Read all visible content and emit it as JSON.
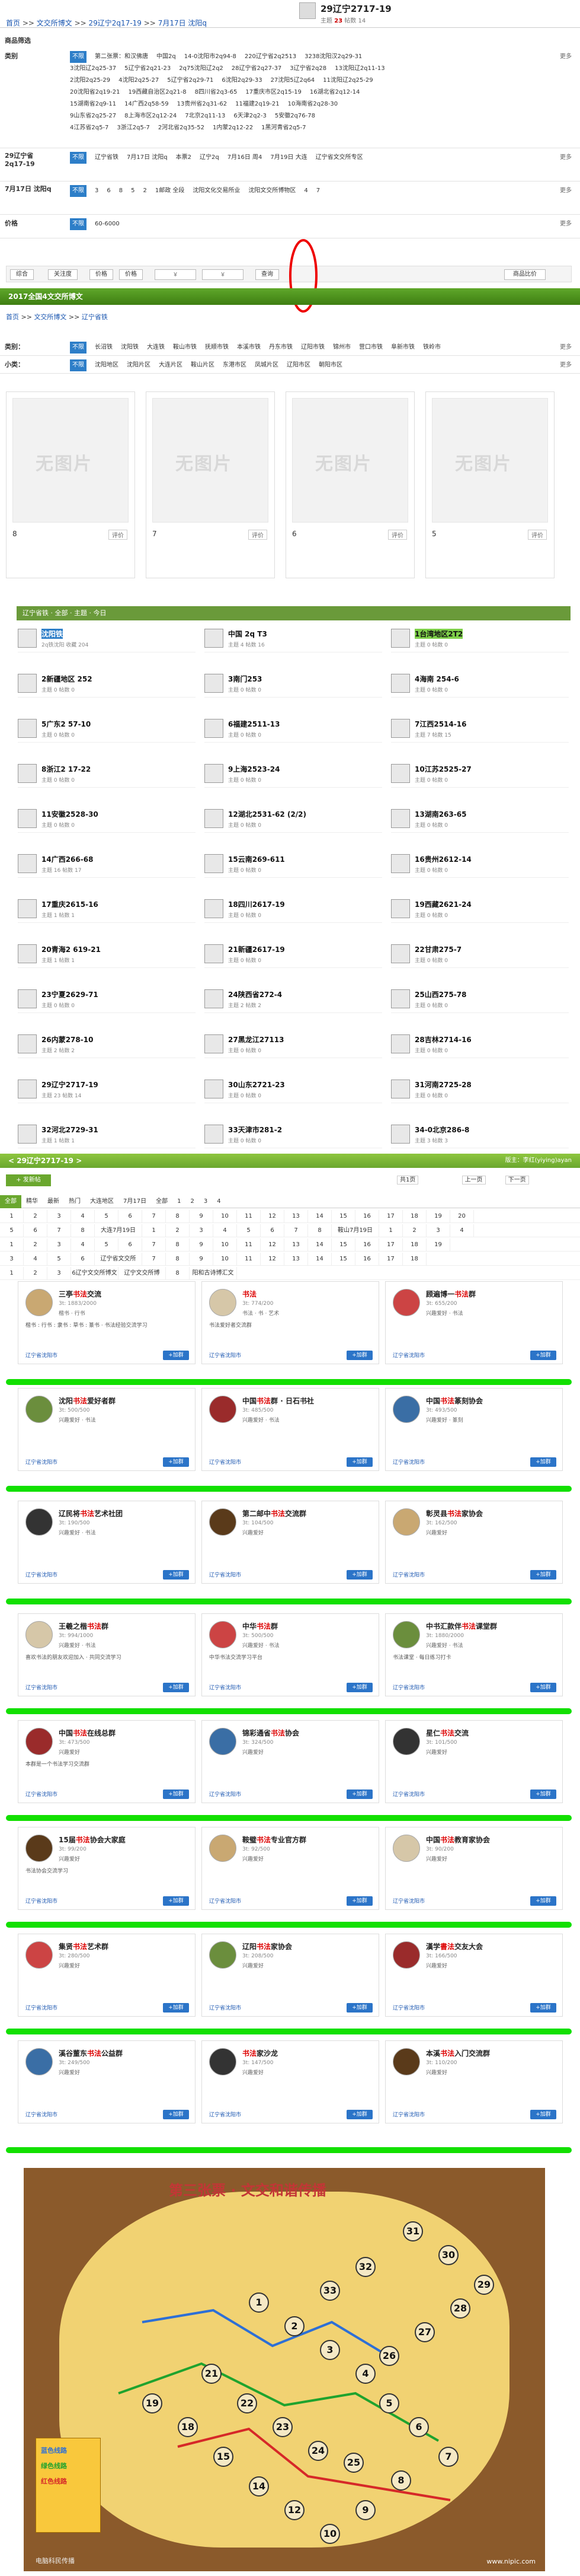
{
  "breadcrumb": [
    "首页",
    "文交所博文",
    "29辽宁2q17-19",
    "7月17日 沈阳q"
  ],
  "item": {
    "title": "29辽宁2717-19",
    "stats_label": "主题",
    "stats_value": "23",
    "stats_more": "帖数 14"
  },
  "product_label": "商品筛选",
  "category": {
    "label": "类别",
    "more": "更多",
    "rows": [
      [
        "不限",
        "第二张票：和汉佛唐",
        "中国2q",
        "14-0沈阳市2q94-8",
        "220辽宁省2q2513",
        "3238沈阳汉2q29-31"
      ],
      [
        "3沈阳辽2q25-37",
        "5辽宁省2q21-23",
        "2q75沈阳辽2q2",
        "28辽宁省2q27-37",
        "3辽宁省2q28",
        "13沈阳辽2q11-13"
      ],
      [
        "2沈阳2q25-29",
        "4沈阳2q25-27",
        "5辽宁省2q29-71",
        "6沈阳2q29-33",
        "27沈阳5辽2q64",
        "11沈阳辽2q25-29"
      ],
      [
        "20沈阳省2q19-21",
        "19西藏自治区2q21-8",
        "8四川省2q3-65",
        "17重庆市区2q15-19",
        "16湖北省2q12-14"
      ],
      [
        "15湖南省2q9-11",
        "14广西2q58-59",
        "13贵州省2q31-62",
        "11福建2q19-21",
        "10海南省2q28-30"
      ],
      [
        "9山东省2q25-27",
        "8上海市区2q12-24",
        "7北京2q11-13",
        "6天津2q2-3",
        "5安徽2q76-78"
      ],
      [
        "4江苏省2q5-7",
        "3浙江2q5-7",
        "2河北省2q35-52",
        "1内蒙2q12-22",
        "1黑河青省2q5-7"
      ]
    ]
  },
  "province": {
    "label": "29辽宁省2q17-19",
    "more": "更多",
    "options": [
      "不限",
      "辽宁省铁",
      "7月17日 沈阳q",
      "本票2",
      "辽宁2q",
      "7月16日 周4",
      "7月19日 大连",
      "辽宁省文交所专区"
    ]
  },
  "date": {
    "label": "7月17日 沈阳q",
    "more": "更多",
    "options": [
      "不限",
      "3",
      "6",
      "8",
      "5",
      "2",
      "1邮政 全段",
      "沈阳文化交易所业",
      "沈阳文交所博物区",
      "4",
      "7"
    ]
  },
  "price": {
    "label": "价格",
    "options": [
      "不限",
      "60-6000"
    ],
    "more": "更多"
  },
  "toolbar": {
    "btn1": "综合",
    "btn2": "关注度",
    "btn3": "价格",
    "btn4": "价格",
    "placeholder": "¥",
    "btn5": "查询",
    "btn6": "商品比价"
  },
  "green_bar_title": "2017全国4文交所博文",
  "sub_breadcrumb": [
    "首页",
    "文交所博文",
    "辽宁省铁"
  ],
  "region": {
    "label": "类别：",
    "more": "更多",
    "options": [
      "不限",
      "长沼铁",
      "沈阳铁",
      "大连铁",
      "鞍山市铁",
      "抚顺市铁",
      "本溪市铁",
      "丹东市铁",
      "辽阳市铁",
      "锦州市",
      "营口市铁",
      "阜新市铁",
      "铁岭市"
    ]
  },
  "small": {
    "label": "小类：",
    "more": "更多",
    "options": [
      "不限",
      "沈阳地区",
      "沈阳片区",
      "大连片区",
      "鞍山片区",
      "东港市区",
      "凤城片区",
      "辽阳市区",
      "朝阳市区"
    ]
  },
  "cards": [
    {
      "no_img": "无图片",
      "num": "8",
      "rate": "评价"
    },
    {
      "no_img": "无图片",
      "num": "7",
      "rate": "评价"
    },
    {
      "no_img": "无图片",
      "num": "6",
      "rate": "评价"
    },
    {
      "no_img": "无图片",
      "num": "5",
      "rate": "评价"
    }
  ],
  "section_bar": "辽宁省铁 · 全部 · 主题 · 今日",
  "subforums": [
    [
      "沈阳铁",
      "2q铁沈阳 收藏 204",
      "中国 2q T3",
      "主题 4 帖数 16",
      "1台湾地区2T2",
      "主题 0 帖数 0"
    ],
    [
      "2新疆地区 252",
      "主题 0 帖数 0",
      "3南门253",
      "主题 0 帖数 0",
      "4海南 254-6",
      "主题 0 帖数 0"
    ],
    [
      "5广东2 57-10",
      "主题 0 帖数 0",
      "6福建2511-13",
      "主题 0 帖数 0",
      "7江西2514-16",
      "主题 7 帖数 15"
    ],
    [
      "8浙江2 17-22",
      "主题 0 帖数 0",
      "9上海2523-24",
      "主题 0 帖数 0",
      "10江苏2525-27",
      "主题 0 帖数 0"
    ],
    [
      "11安徽2528-30",
      "主题 0 帖数 0",
      "12湖北2531-62 (2/2)",
      "主题 0 帖数 0",
      "13湖南263-65",
      "主题 0 帖数 0"
    ],
    [
      "14广西266-68",
      "主题 16 帖数 17",
      "15云南269-611",
      "主题 0 帖数 0",
      "16贵州2612-14",
      "主题 0 帖数 0"
    ],
    [
      "17重庆2615-16",
      "主题 1 帖数 1",
      "18四川2617-19",
      "主题 0 帖数 0",
      "19西藏2621-24",
      "主题 0 帖数 0"
    ],
    [
      "20青海2 619-21",
      "主题 1 帖数 1",
      "21新疆2617-19",
      "主题 0 帖数 0",
      "22甘肃275-7",
      "主题 0 帖数 0"
    ],
    [
      "23宁夏2629-71",
      "主题 0 帖数 0",
      "24陕西省272-4",
      "主题 2 帖数 2",
      "25山西275-78",
      "主题 0 帖数 0"
    ],
    [
      "26内蒙278-10",
      "主题 2 帖数 2",
      "27黑龙江27113",
      "主题 0 帖数 0",
      "28吉林2714-16",
      "主题 0 帖数 0"
    ],
    [
      "29辽宁2717-19",
      "主题 23 帖数 14",
      "30山东2721-23",
      "主题 0 帖数 0",
      "31河南2725-28",
      "主题 0 帖数 0"
    ],
    [
      "32河北2729-31",
      "主题 1 帖数 1",
      "33天津市281-2",
      "主题 0 帖数 0",
      "34-0北京286-8",
      "主题 3 帖数 3"
    ]
  ],
  "thread_bar": "< 29辽宁2717-19 >",
  "thread_bar_right": "版主：李红(yiying)ayan",
  "post_btn": "+ 发新帖",
  "pager": {
    "label": "共1页",
    "prev": "上一页",
    "next": "下一页"
  },
  "tabs": [
    "全部",
    "精华",
    "最新",
    "热门",
    "大连地区",
    "7月17日",
    "全部",
    "1",
    "2",
    "3",
    "4"
  ],
  "grid_rows": [
    [
      "1",
      "2",
      "3",
      "4",
      "5",
      "6",
      "7",
      "8",
      "9",
      "10",
      "11",
      "12",
      "13",
      "14",
      "15",
      "16",
      "17",
      "18",
      "19",
      "20"
    ],
    [
      "5",
      "6",
      "7",
      "8",
      "大连7月19日",
      "1",
      "2",
      "3",
      "4",
      "5",
      "6",
      "7",
      "8",
      "鞍山7月19日",
      "1",
      "2",
      "3",
      "4"
    ],
    [
      "1",
      "2",
      "3",
      "4",
      "5",
      "6",
      "7",
      "8",
      "9",
      "10",
      "11",
      "12",
      "13",
      "14",
      "15",
      "16",
      "17",
      "18",
      "19"
    ],
    [
      "3",
      "4",
      "5",
      "6",
      "辽宁省文交所",
      "7",
      "8",
      "9",
      "10",
      "11",
      "12",
      "13",
      "14",
      "15",
      "16",
      "17",
      "18"
    ],
    [
      "1",
      "2",
      "3",
      "6辽宁文交所博文",
      "辽宁文交所博",
      "8",
      "阳和古诗博汇文"
    ]
  ],
  "groups": [
    {
      "name_pre": "三亭",
      "name_kw": "书法",
      "name_post": "交流",
      "members": "3t: 1883/2000",
      "tags": "楷书 · 行书",
      "desc": "楷书 : 行书 : 隶书 : 草书 : 篆书 · 书法经验交流学习",
      "loc": "辽宁省沈阳市",
      "join": "+加群"
    },
    {
      "name_pre": "",
      "name_kw": "书法",
      "name_post": "",
      "members": "3t: 774/200",
      "tags": "书法 · 书 · 艺术",
      "desc": "书法爱好者交流群",
      "loc": "辽宁省沈阳市",
      "join": "+加群"
    },
    {
      "name_pre": "顾遍博一",
      "name_kw": "书法",
      "name_post": "群",
      "members": "3t: 655/200",
      "tags": "兴趣爱好 · 书法",
      "desc": "",
      "loc": "辽宁省沈阳市",
      "join": "+加群"
    },
    {
      "name_pre": "沈阳",
      "name_kw": "书法",
      "name_post": "爱好者群",
      "members": "3t: 500/500",
      "tags": "兴趣爱好 · 书法",
      "desc": "",
      "loc": "辽宁省沈阳市",
      "join": "+加群"
    },
    {
      "name_pre": "中国",
      "name_kw": "书法",
      "name_post": "群 · 日石书社",
      "members": "3t: 485/500",
      "tags": "兴趣爱好 · 书法",
      "desc": "",
      "loc": "辽宁省沈阳市",
      "join": "+加群"
    },
    {
      "name_pre": "中国",
      "name_kw": "书法",
      "name_post": "篆刻协会",
      "members": "3t: 493/500",
      "tags": "兴趣爱好 · 篆刻",
      "desc": "",
      "loc": "辽宁省沈阳市",
      "join": "+加群"
    },
    {
      "name_pre": "辽民将",
      "name_kw": "书法",
      "name_post": "艺术社团",
      "members": "3t: 190/500",
      "tags": "兴趣爱好 · 书法",
      "desc": "",
      "loc": "辽宁省沈阳市",
      "join": "+加群"
    },
    {
      "name_pre": "第二邮中",
      "name_kw": "书法",
      "name_post": "交流群",
      "members": "3t: 104/500",
      "tags": "兴趣爱好",
      "desc": "",
      "loc": "辽宁省沈阳市",
      "join": "+加群"
    },
    {
      "name_pre": "彰灵县",
      "name_kw": "书法",
      "name_post": "家协会",
      "members": "3t: 162/500",
      "tags": "兴趣爱好",
      "desc": "",
      "loc": "辽宁省沈阳市",
      "join": "+加群"
    },
    {
      "name_pre": "王羲之楷",
      "name_kw": "书法",
      "name_post": "群",
      "members": "3t: 994/1000",
      "tags": "兴趣爱好 · 书法",
      "desc": "喜欢书法的朋友欢迎加入 · 共同交流学习",
      "loc": "辽宁省沈阳市",
      "join": "+加群"
    },
    {
      "name_pre": "中华",
      "name_kw": "书法",
      "name_post": "群",
      "members": "3t: 500/500",
      "tags": "兴趣爱好 · 书法",
      "desc": "中华书法交流学习平台",
      "loc": "辽宁省沈阳市",
      "join": "+加群"
    },
    {
      "name_pre": "中书汇款伴",
      "name_kw": "书法",
      "name_post": "课堂群",
      "members": "3t: 1880/2000",
      "tags": "兴趣爱好 · 书法",
      "desc": "书法课堂 · 每日练习打卡",
      "loc": "辽宁省沈阳市",
      "join": "+加群"
    },
    {
      "name_pre": "中国",
      "name_kw": "书法",
      "name_post": "在线总群",
      "members": "3t: 473/500",
      "tags": "兴趣爱好",
      "desc": "本群是一个书法学习交流群",
      "loc": "辽宁省沈阳市",
      "join": "+加群"
    },
    {
      "name_pre": "锦彩通省",
      "name_kw": "书法",
      "name_post": "协会",
      "members": "3t: 324/500",
      "tags": "兴趣爱好",
      "desc": "",
      "loc": "辽宁省沈阳市",
      "join": "+加群"
    },
    {
      "name_pre": "星仁",
      "name_kw": "书法",
      "name_post": "交流",
      "members": "3t: 101/500",
      "tags": "兴趣爱好",
      "desc": "",
      "loc": "辽宁省沈阳市",
      "join": "+加群"
    },
    {
      "name_pre": "15届",
      "name_kw": "书法",
      "name_post": "协会大家庭",
      "members": "3t: 99/200",
      "tags": "兴趣爱好",
      "desc": "书法协会交流学习",
      "loc": "辽宁省沈阳市",
      "join": "+加群"
    },
    {
      "name_pre": "鞍璧",
      "name_kw": "书法",
      "name_post": "专业官方群",
      "members": "3t: 92/500",
      "tags": "兴趣爱好",
      "desc": "",
      "loc": "辽宁省沈阳市",
      "join": "+加群"
    },
    {
      "name_pre": "中国",
      "name_kw": "书法",
      "name_post": "教育家协会",
      "members": "3t: 90/200",
      "tags": "兴趣爱好",
      "desc": "",
      "loc": "辽宁省沈阳市",
      "join": "+加群"
    },
    {
      "name_pre": "集贤",
      "name_kw": "书法",
      "name_post": "艺术群",
      "members": "3t: 280/500",
      "tags": "兴趣爱好",
      "desc": "",
      "loc": "辽宁省沈阳市",
      "join": "+加群"
    },
    {
      "name_pre": "辽阳",
      "name_kw": "书法",
      "name_post": "家协会",
      "members": "3t: 208/500",
      "tags": "兴趣爱好",
      "desc": "",
      "loc": "辽宁省沈阳市",
      "join": "+加群"
    },
    {
      "name_pre": "漢学",
      "name_kw": "書法",
      "name_post": "交友大会",
      "members": "3t: 166/500",
      "tags": "兴趣爱好",
      "desc": "",
      "loc": "辽宁省沈阳市",
      "join": "+加群"
    },
    {
      "name_pre": "溪谷董东",
      "name_kw": "书法",
      "name_post": "公益群",
      "members": "3t: 249/500",
      "tags": "兴趣爱好",
      "desc": "",
      "loc": "辽宁省沈阳市",
      "join": "+加群"
    },
    {
      "name_pre": "",
      "name_kw": "书法",
      "name_post": "家沙龙",
      "members": "3t: 147/500",
      "tags": "兴趣爱好",
      "desc": "",
      "loc": "辽宁省沈阳市",
      "join": "+加群"
    },
    {
      "name_pre": "本溪",
      "name_kw": "书法",
      "name_post": "入门交流群",
      "members": "3t: 110/200",
      "tags": "兴趣爱好",
      "desc": "",
      "loc": "辽宁省沈阳市",
      "join": "+加群"
    }
  ],
  "map": {
    "title": "第三张票 · 文交和谐传播",
    "legend": [
      "蓝色线路",
      "绿色线路",
      "红色线路"
    ],
    "watermark": "www.nipic.com",
    "watermark2": "电脑科民传播",
    "pins": [
      "1",
      "2",
      "3",
      "4",
      "5",
      "6",
      "7",
      "8",
      "9",
      "10",
      "12",
      "14",
      "15",
      "18",
      "19",
      "21",
      "22",
      "23",
      "24",
      "25",
      "26",
      "27",
      "28",
      "29",
      "30",
      "31",
      "32",
      "33"
    ]
  }
}
